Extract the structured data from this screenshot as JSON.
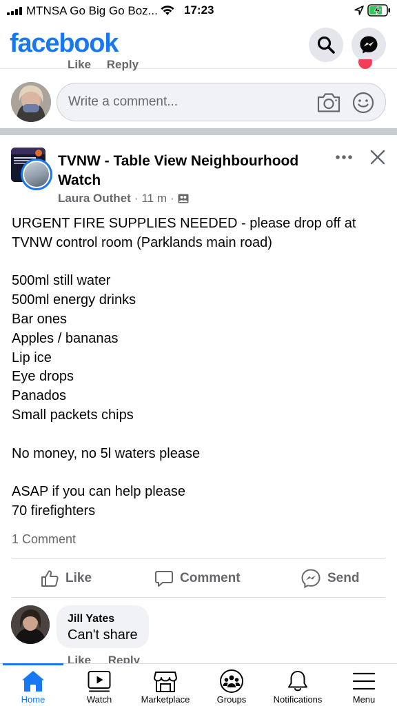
{
  "status_bar": {
    "carrier": "MTNSA Go Big Go Boz...",
    "time": "17:23"
  },
  "header": {
    "logo": "facebook",
    "brand_color": "#1877f2"
  },
  "previous_post": {
    "like_label": "Like",
    "reply_label": "Reply"
  },
  "composer": {
    "placeholder": "Write a comment...",
    "camera_icon": "camera-icon",
    "emoji_icon": "emoji-icon"
  },
  "post": {
    "group_name": "TVNW - Table View Neighbourhood Watch",
    "author": "Laura Outhet",
    "time": "11 m",
    "audience_icon": "group-audience-icon",
    "body": [
      "URGENT FIRE SUPPLIES NEEDED - please drop off at TVNW control room (Parklands main road)",
      "",
      "500ml still water",
      "500ml energy drinks",
      "Bar ones",
      "Apples / bananas",
      "Lip ice",
      "Eye drops",
      "Panados",
      "Small packets chips",
      "",
      "No money, no 5l waters please",
      "",
      "ASAP if you can help please",
      "70 firefighters"
    ],
    "comment_count": "1 Comment",
    "actions": {
      "like": "Like",
      "comment": "Comment",
      "send": "Send"
    }
  },
  "comment": {
    "name": "Jill Yates",
    "text": "Can't share",
    "like_label": "Like",
    "reply_label": "Reply"
  },
  "nav": {
    "items": [
      {
        "label": "Home",
        "icon": "home-icon",
        "active": true
      },
      {
        "label": "Watch",
        "icon": "watch-icon",
        "active": false
      },
      {
        "label": "Marketplace",
        "icon": "marketplace-icon",
        "active": false
      },
      {
        "label": "Groups",
        "icon": "groups-icon",
        "active": false
      },
      {
        "label": "Notifications",
        "icon": "notifications-icon",
        "active": false
      },
      {
        "label": "Menu",
        "icon": "menu-icon",
        "active": false
      }
    ]
  }
}
